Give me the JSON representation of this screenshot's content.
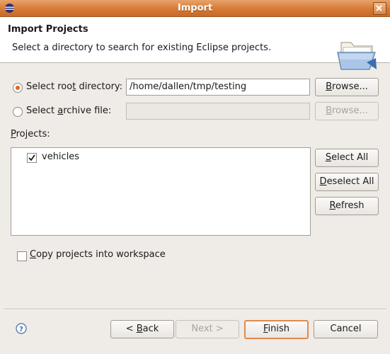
{
  "window": {
    "title": "Import"
  },
  "header": {
    "title": "Import Projects",
    "subtitle": "Select a directory to search for existing Eclipse projects."
  },
  "source": {
    "root_radio": {
      "pre": "Select roo",
      "key": "t",
      "post": " directory:",
      "selected": true
    },
    "root_path": "/home/dallen/tmp/testing",
    "archive_radio": {
      "pre": "Select ",
      "key": "a",
      "post": "rchive file:",
      "selected": false
    },
    "archive_path": "",
    "browse_pre": "",
    "browse_key": "B",
    "browse_post": "rowse..."
  },
  "projects": {
    "label_key": "P",
    "label_post": "rojects:",
    "items": [
      {
        "name": "vehicles",
        "checked": true
      }
    ],
    "select_all": {
      "key": "S",
      "post": "elect All"
    },
    "deselect_all": {
      "key": "D",
      "post": "eselect All"
    },
    "refresh": {
      "key": "R",
      "post": "efresh"
    }
  },
  "copy_option": {
    "key": "C",
    "post": "opy projects into workspace",
    "checked": false
  },
  "footer": {
    "back": {
      "pre": "< ",
      "key": "B",
      "post": "ack"
    },
    "next": "Next >",
    "finish": {
      "key": "F",
      "post": "inish"
    },
    "cancel": "Cancel"
  },
  "colors": {
    "titlebar": "#d67a36",
    "accent": "#e0661c",
    "background": "#efebe7"
  }
}
